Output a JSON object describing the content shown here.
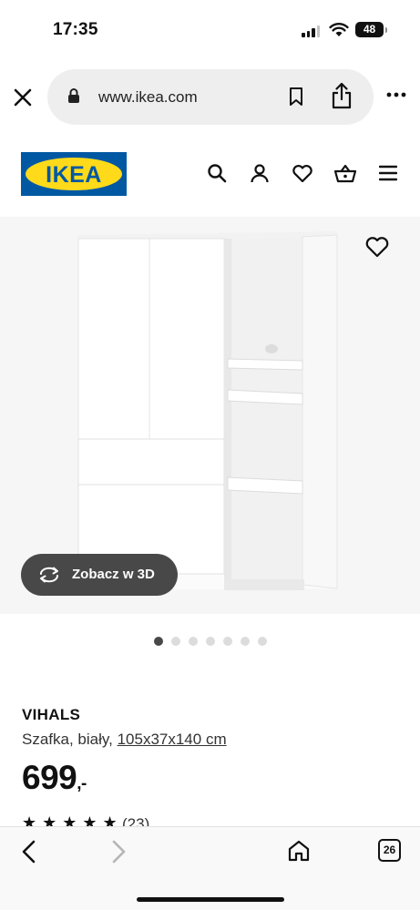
{
  "status_bar": {
    "time": "17:35",
    "battery": "48",
    "icons": [
      "signal-icon",
      "wifi-icon",
      "battery-icon"
    ]
  },
  "browser": {
    "url": "www.ikea.com",
    "icons": [
      "close-icon",
      "lock-icon",
      "bookmark-icon",
      "share-icon",
      "more-icon"
    ]
  },
  "header": {
    "logo_text": "IKEA",
    "icons": [
      "search-icon",
      "account-icon",
      "heart-icon",
      "basket-icon",
      "menu-icon"
    ]
  },
  "product": {
    "view_3d_label": "Zobacz w 3D",
    "image_count": 7,
    "active_image": 1,
    "name": "VIHALS",
    "description": "Szafka, biały, ",
    "dimensions": "105x37x140 cm",
    "price": "699",
    "price_suffix": ",-",
    "rating_value": 5,
    "rating_max": 5,
    "rating_stars": "★★★★★",
    "rating_count": "(23)"
  },
  "toolbar": {
    "tab_count": "26",
    "icons": [
      "back-icon",
      "forward-icon",
      "home-icon",
      "tabs-icon"
    ]
  },
  "colors": {
    "ikea_blue": "#0058a3",
    "ikea_yellow": "#ffda1a",
    "button_dark": "#484848"
  }
}
